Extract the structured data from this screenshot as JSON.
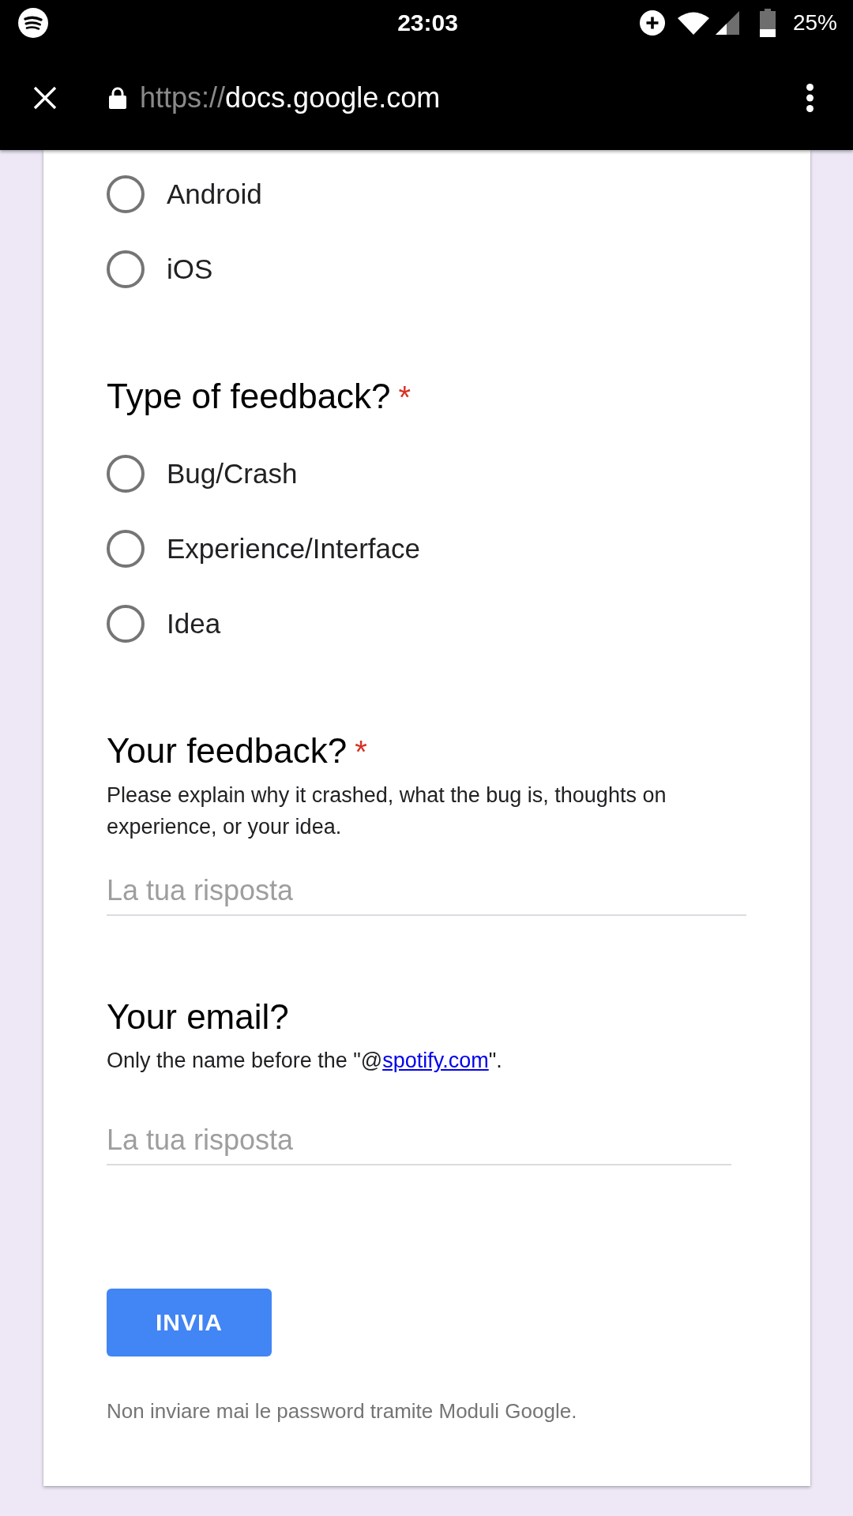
{
  "status_bar": {
    "time": "23:03",
    "battery_text": "25%"
  },
  "toolbar": {
    "url_scheme": "https://",
    "url_host": "docs.google.com"
  },
  "questions": [
    {
      "kind": "choice",
      "options": [
        {
          "label": "Android",
          "selected": false
        },
        {
          "label": "iOS",
          "selected": false
        }
      ]
    },
    {
      "kind": "choice",
      "title": "Type of feedback?",
      "required_mark": "*",
      "options": [
        {
          "label": "Bug/Crash",
          "selected": false
        },
        {
          "label": "Experience/Interface",
          "selected": false
        },
        {
          "label": "Idea",
          "selected": false
        }
      ]
    },
    {
      "kind": "text",
      "title": "Your feedback?",
      "required_mark": "*",
      "description": [
        {
          "kind": "plain",
          "text": "Please explain why it crashed, what the bug is, thoughts on experience, or your idea."
        }
      ],
      "placeholder": "La tua risposta"
    },
    {
      "kind": "text",
      "title": "Your email?",
      "description": [
        {
          "kind": "plain",
          "text": "Only the name before the \"@"
        },
        {
          "kind": "link",
          "text": "spotify.com"
        },
        {
          "kind": "plain",
          "text": "\"."
        }
      ],
      "placeholder": "La tua risposta"
    }
  ],
  "submit_button": "INVIA",
  "footer_note": "Non inviare mai le password tramite Moduli Google."
}
